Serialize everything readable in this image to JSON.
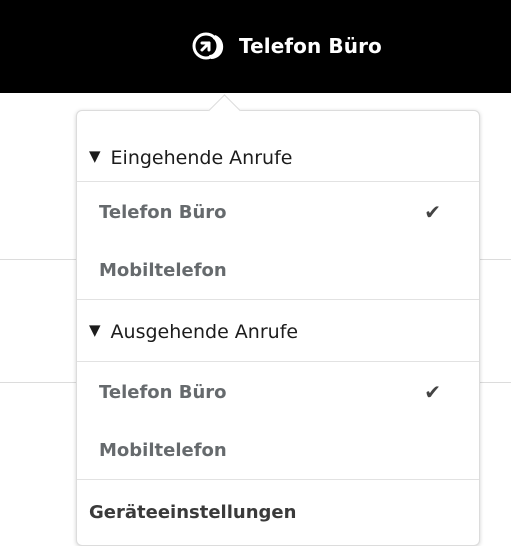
{
  "header": {
    "phone_icon": "phone-forward-icon",
    "phone_label": "Telefon Büro"
  },
  "menu": {
    "incoming": {
      "title": "Eingehende Anrufe",
      "items": [
        {
          "label": "Telefon Büro",
          "selected": true,
          "check": "✔"
        },
        {
          "label": "Mobiltelefon",
          "selected": false,
          "check": ""
        }
      ]
    },
    "outgoing": {
      "title": "Ausgehende Anrufe",
      "items": [
        {
          "label": "Telefon Büro",
          "selected": true,
          "check": "✔"
        },
        {
          "label": "Mobiltelefon",
          "selected": false,
          "check": ""
        }
      ]
    },
    "settings_label": "Geräteeinstellungen"
  },
  "colors": {
    "topbar": "#000000",
    "item_text": "#666a6d",
    "header_text": "#1c1c1c"
  }
}
